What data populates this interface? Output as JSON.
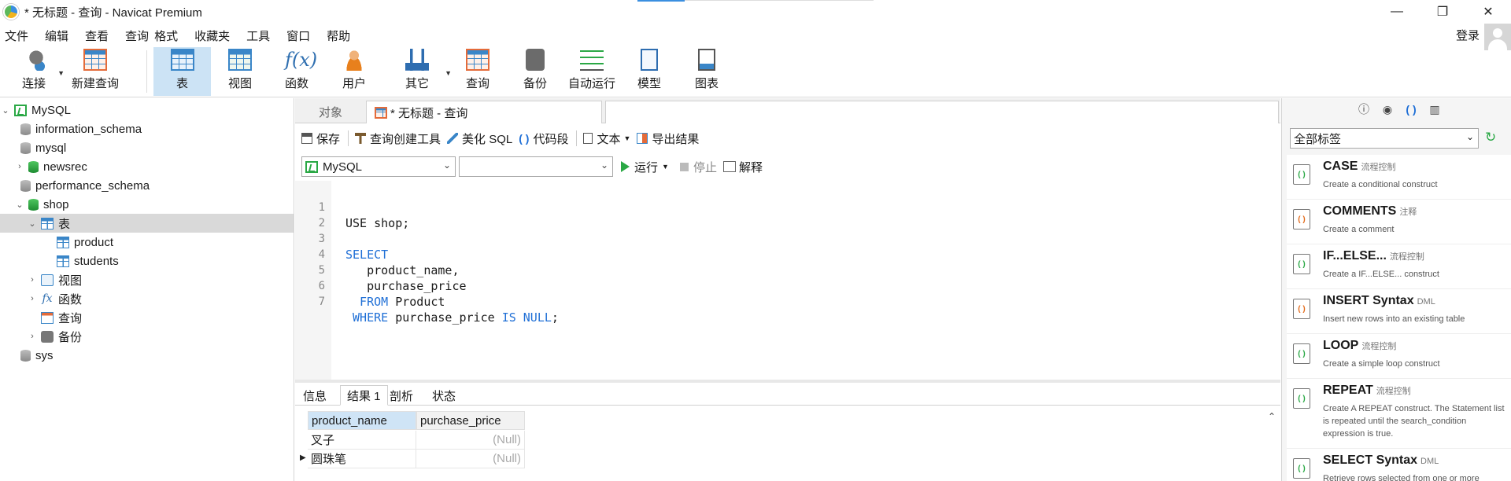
{
  "window": {
    "title": "* 无标题 - 查询 - Navicat Premium",
    "minimize": "—",
    "maximize": "❐",
    "close": "✕"
  },
  "menu": {
    "items": [
      "文件",
      "编辑",
      "查看",
      "查询",
      "格式",
      "工具",
      "收藏夹",
      "工具",
      "窗口",
      "帮助"
    ],
    "login": "登录"
  },
  "toolbar": {
    "connect": "连接",
    "new_query": "新建查询",
    "table": "表",
    "view": "视图",
    "function": "函数",
    "user": "用户",
    "other": "其它",
    "query": "查询",
    "backup": "备份",
    "automation": "自动运行",
    "model": "模型",
    "chart": "图表"
  },
  "tree": {
    "root": "MySQL",
    "db1": "information_schema",
    "db2": "mysql",
    "db3": "newsrec",
    "db4": "performance_schema",
    "db5": "shop",
    "tables_node": "表",
    "table1": "product",
    "table2": "students",
    "views_node": "视图",
    "functions_node": "函数",
    "queries_node": "查询",
    "backups_node": "备份",
    "db6": "sys"
  },
  "tabs": {
    "objects": "对象",
    "query": "* 无标题 - 查询"
  },
  "query_toolbar": {
    "save": "保存",
    "query_builder": "查询创建工具",
    "beautify": "美化 SQL",
    "snippet": "代码段",
    "text": "文本",
    "export": "导出结果"
  },
  "select_bar": {
    "connection": "MySQL",
    "database": "",
    "run": "运行",
    "stop": "停止",
    "explain": "解释"
  },
  "editor": {
    "lines": [
      {
        "n": "1",
        "code": "USE shop;"
      },
      {
        "n": "2",
        "code": ""
      },
      {
        "n": "3",
        "kw": "SELECT",
        "code": ""
      },
      {
        "n": "4",
        "code": "   product_name,"
      },
      {
        "n": "5",
        "code": "   purchase_price"
      },
      {
        "n": "6",
        "kw": "  FROM",
        "code": " Product"
      },
      {
        "n": "7",
        "kw": " WHERE",
        "code": " purchase_price ",
        "kw2": "IS NULL",
        "tail": ";"
      }
    ]
  },
  "result_tabs": {
    "info": "信息",
    "result1": "结果 1",
    "profile": "剖析",
    "status": "状态"
  },
  "result_grid": {
    "columns": [
      "product_name",
      "purchase_price"
    ],
    "rows": [
      [
        "叉子",
        "(Null)"
      ],
      [
        "圆珠笔",
        "(Null)"
      ]
    ]
  },
  "right_panel": {
    "tag_filter": "全部标签",
    "snippets": [
      {
        "title": "CASE",
        "tag": "流程控制",
        "desc": "Create a conditional construct"
      },
      {
        "title": "COMMENTS",
        "tag": "注释",
        "desc": "Create a comment"
      },
      {
        "title": "IF...ELSE...",
        "tag": "流程控制",
        "desc": "Create a IF...ELSE... construct"
      },
      {
        "title": "INSERT Syntax",
        "tag": "DML",
        "desc": "Insert new rows into an existing table"
      },
      {
        "title": "LOOP",
        "tag": "流程控制",
        "desc": "Create a simple loop construct"
      },
      {
        "title": "REPEAT",
        "tag": "流程控制",
        "desc": "Create A REPEAT construct. The Statement list is repeated until the search_condition expression is true."
      },
      {
        "title": "SELECT Syntax",
        "tag": "DML",
        "desc": "Retrieve rows selected from one or more"
      }
    ]
  },
  "colors": {
    "accent": "#1f6fd6",
    "selection": "#cce3f5",
    "run_green": "#2aa845"
  }
}
